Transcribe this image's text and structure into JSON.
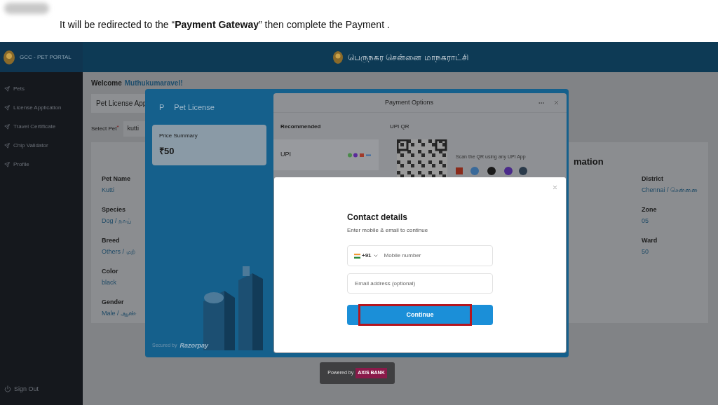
{
  "caption": "It will be redirected to the “**Payment Gateway**” then complete the Payment .",
  "portal": {
    "brand": "GCC - PET PORTAL",
    "header_title": "பெருநகர சென்னை மாநகராட்சி",
    "sidebar": {
      "items": [
        "Pets",
        "License Application",
        "Travel Certificate",
        "Chip Validator",
        "Profile"
      ],
      "sign_out": "Sign Out"
    },
    "welcome": {
      "label": "Welcome",
      "user": "Muthukumaravel!"
    },
    "tab": "Pet License App",
    "select_pet": {
      "label": "Select Pet",
      "required_mark": "*",
      "value": "kutti"
    },
    "card": {
      "heading": "mation",
      "left_fields": [
        {
          "label": "Pet Name",
          "value": "Kutti"
        },
        {
          "label": "Species",
          "value": "Dog / நாய்"
        },
        {
          "label": "Breed",
          "value": "Others / மற்"
        },
        {
          "label": "Color",
          "value": "black"
        },
        {
          "label": "Gender",
          "value": "Male / ஆண்"
        }
      ],
      "right_fields": [
        {
          "label": "District",
          "value": "Chennai / சென்னை"
        },
        {
          "label": "Zone",
          "value": "05"
        },
        {
          "label": "Ward",
          "value": "50"
        }
      ]
    }
  },
  "checkout": {
    "brand_initial": "P",
    "brand_name": "Pet License",
    "price_label": "Price Summary",
    "price": "₹50",
    "secured_by": "Secured by",
    "secured_brand": "Razorpay",
    "payment_options": {
      "title": "Payment Options",
      "recommended": "Recommended",
      "upi": "UPI",
      "upi_qr": "UPI QR",
      "scan_hint": "Scan the QR using any UPI App"
    }
  },
  "contact": {
    "title": "Contact details",
    "subtitle": "Enter mobile & email to continue",
    "country_code": "+91",
    "mobile_placeholder": "Mobile number",
    "email_placeholder": "Email address (optional)",
    "button": "Continue",
    "highlighted": true
  },
  "powered_by": {
    "label": "Powered by",
    "bank": "AXIS BANK"
  }
}
